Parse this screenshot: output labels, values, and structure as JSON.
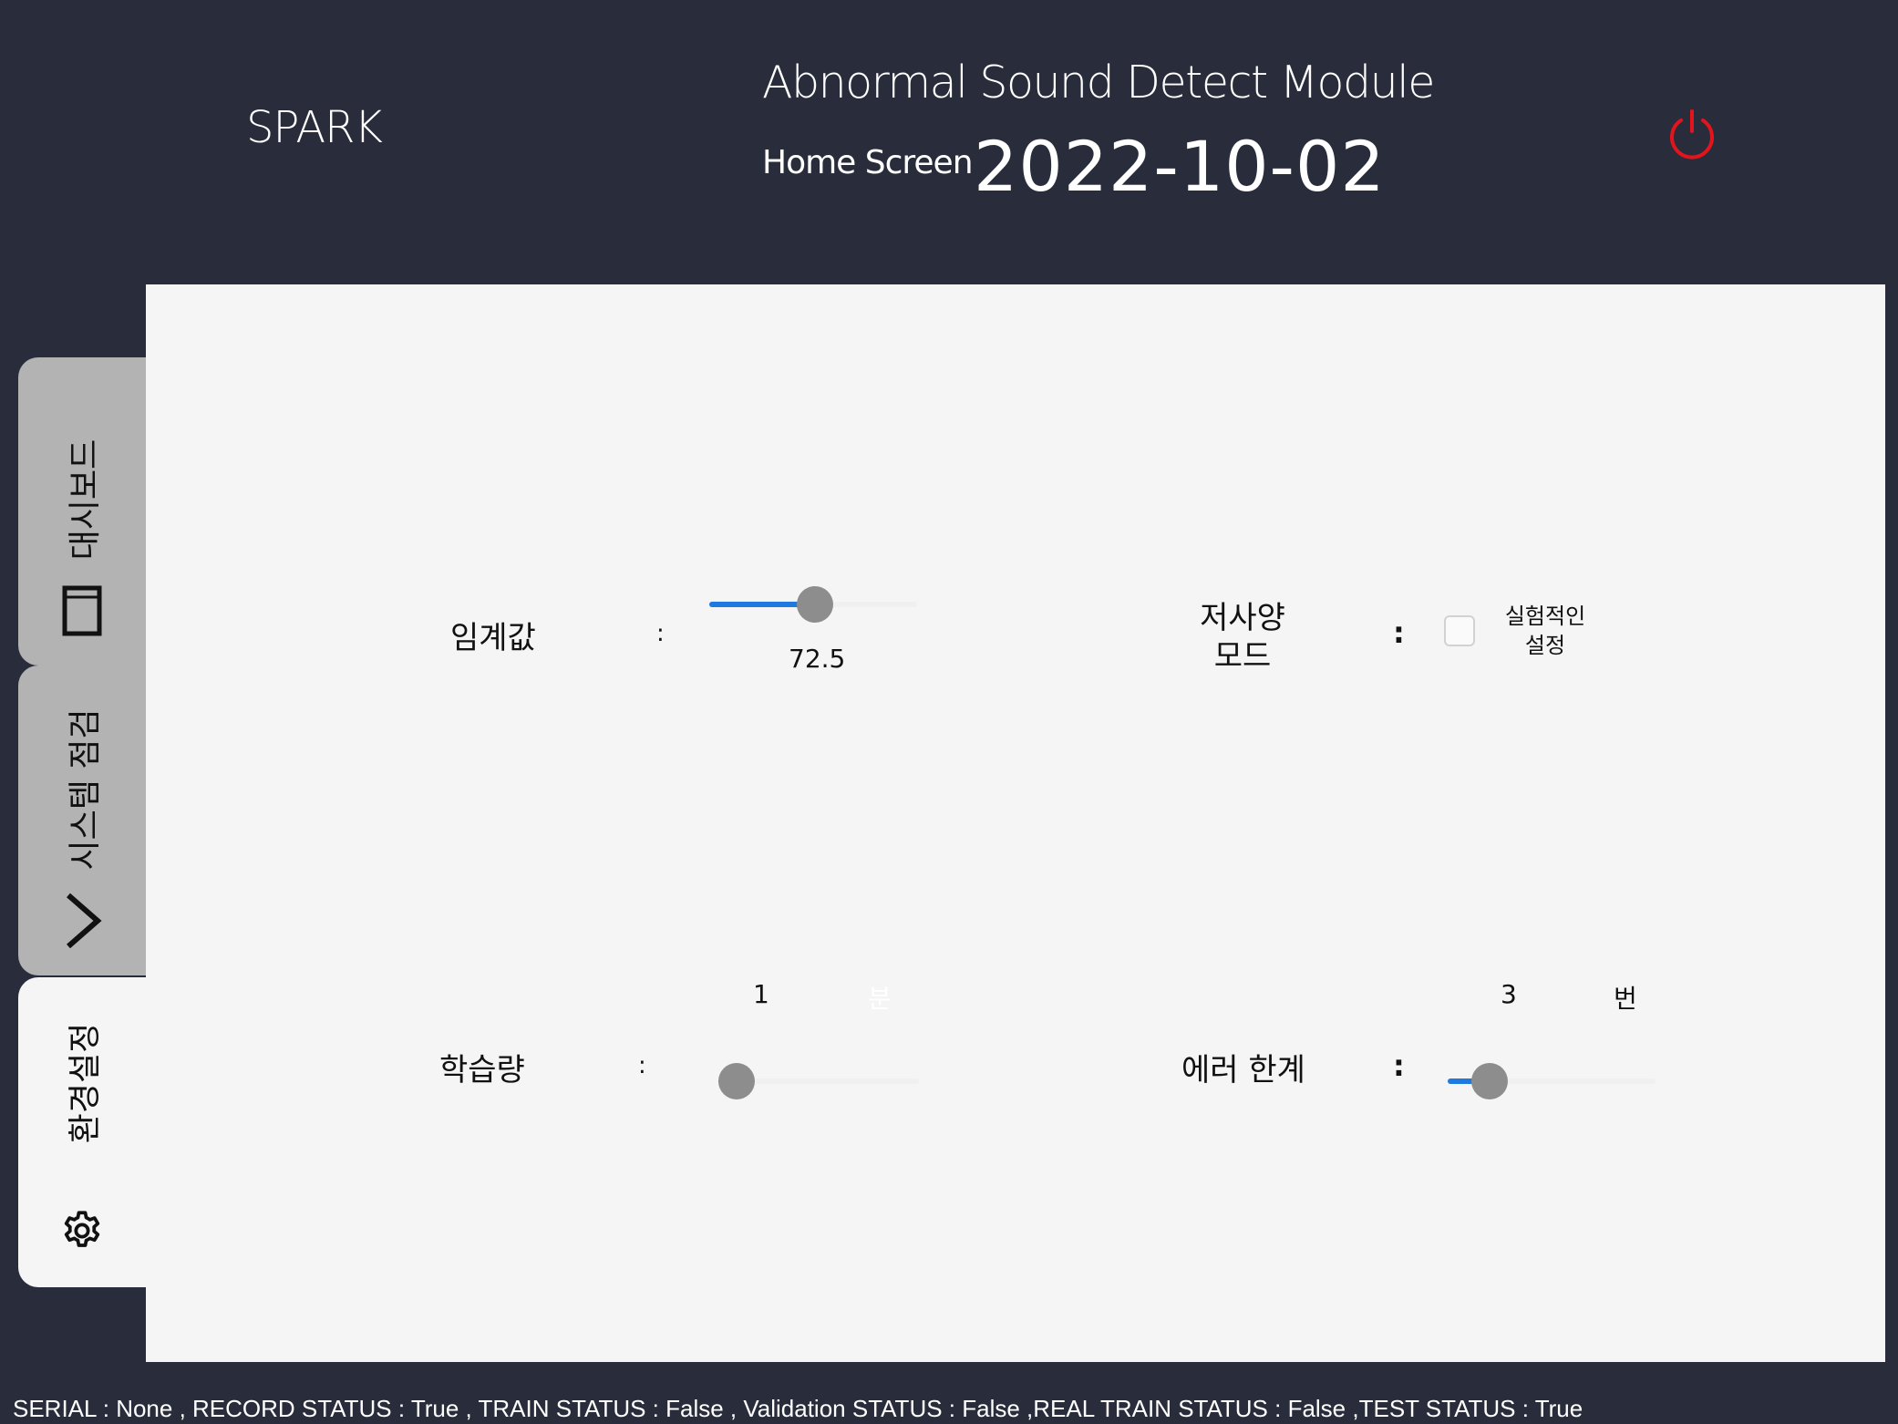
{
  "header": {
    "brand": "SPARK",
    "title": "Abnormal Sound Detect Module",
    "screen_name": "Home Screen",
    "date": "2022-10-02",
    "power_icon": "power-icon",
    "power_color": "#e3141c"
  },
  "sidebar": {
    "tabs": [
      {
        "label": "대시보드",
        "icon": "dashboard-window-icon",
        "active": false
      },
      {
        "label": "시스템 점검",
        "icon": "chevron-right-icon",
        "active": false
      },
      {
        "label": "환경설정",
        "icon": "gear-icon",
        "active": true
      }
    ]
  },
  "settings": {
    "threshold": {
      "label": "임계값",
      "colon": ":",
      "value": "72.5",
      "fill_fraction": 0.51
    },
    "low_spec": {
      "label_line1": "저사양",
      "label_line2": "모드",
      "colon": ":",
      "checked": false,
      "option_line1": "실험적인",
      "option_line2": "설정"
    },
    "training": {
      "label": "학습량",
      "colon": ":",
      "value": "1",
      "unit": "분",
      "fill_fraction": 0.0
    },
    "error_limit": {
      "label": "에러 한계",
      "colon": ":",
      "value": "3",
      "unit": "번",
      "fill_fraction": 0.2
    }
  },
  "status_bar": {
    "text": "SERIAL : None , RECORD STATUS : True , TRAIN STATUS : False , Validation STATUS : False ,REAL TRAIN STATUS : False ,TEST STATUS : True"
  },
  "colors": {
    "background": "#292d3b",
    "panel": "#f5f5f5",
    "inactive_tab": "#b3b3b3",
    "slider_accent": "#1f7ae0",
    "slider_thumb": "#8d8d8d"
  }
}
